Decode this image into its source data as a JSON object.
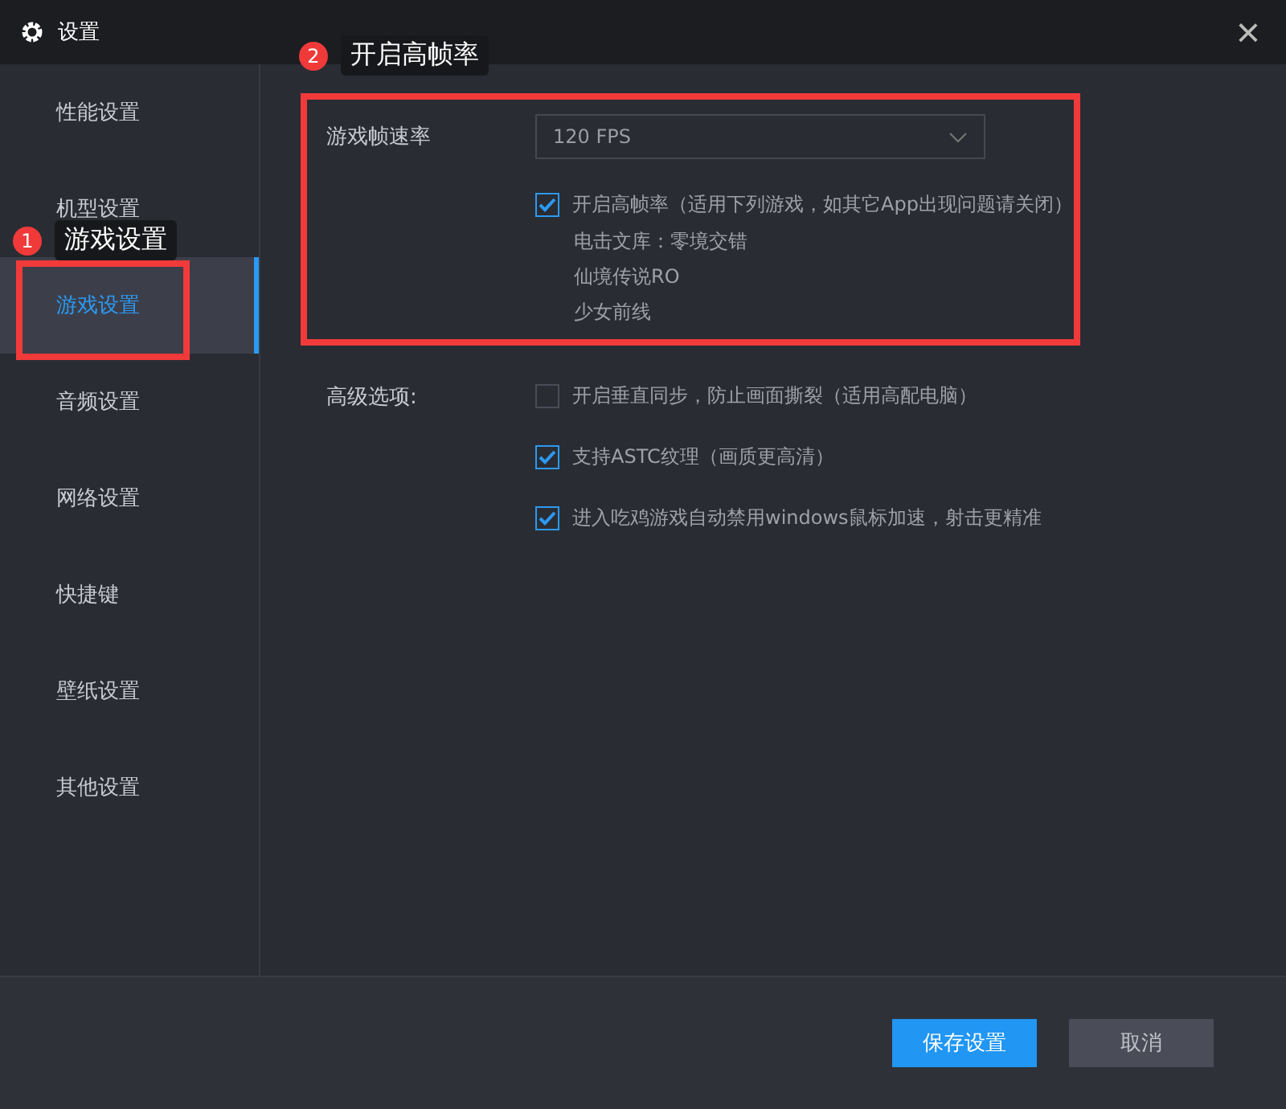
{
  "window": {
    "title": "设置",
    "close": "×"
  },
  "sidebar": {
    "items": [
      {
        "label": "性能设置",
        "selected": false
      },
      {
        "label": "机型设置",
        "selected": false
      },
      {
        "label": "游戏设置",
        "selected": true
      },
      {
        "label": "音频设置",
        "selected": false
      },
      {
        "label": "网络设置",
        "selected": false
      },
      {
        "label": "快捷键",
        "selected": false
      },
      {
        "label": "壁纸设置",
        "selected": false
      },
      {
        "label": "其他设置",
        "selected": false
      }
    ]
  },
  "annotations": [
    {
      "number": "1",
      "label": "游戏设置"
    },
    {
      "number": "2",
      "label": "开启高帧率"
    }
  ],
  "frame_rate": {
    "label": "游戏帧速率",
    "value": "120 FPS"
  },
  "high_fps": {
    "label": "开启高帧率（适用下列游戏，如其它App出现问题请关闭）",
    "checked": true,
    "games": [
      "电击文库：零境交错",
      "仙境传说RO",
      "少女前线"
    ]
  },
  "advanced": {
    "label": "高级选项:",
    "options": [
      {
        "label": "开启垂直同步，防止画面撕裂（适用高配电脑）",
        "checked": false
      },
      {
        "label": "支持ASTC纹理（画质更高清）",
        "checked": true
      },
      {
        "label": "进入吃鸡游戏自动禁用windows鼠标加速，射击更精准",
        "checked": true
      }
    ]
  },
  "buttons": [
    {
      "label": "保存设置",
      "kind": "primary"
    },
    {
      "label": "取消",
      "kind": "secondary"
    }
  ]
}
